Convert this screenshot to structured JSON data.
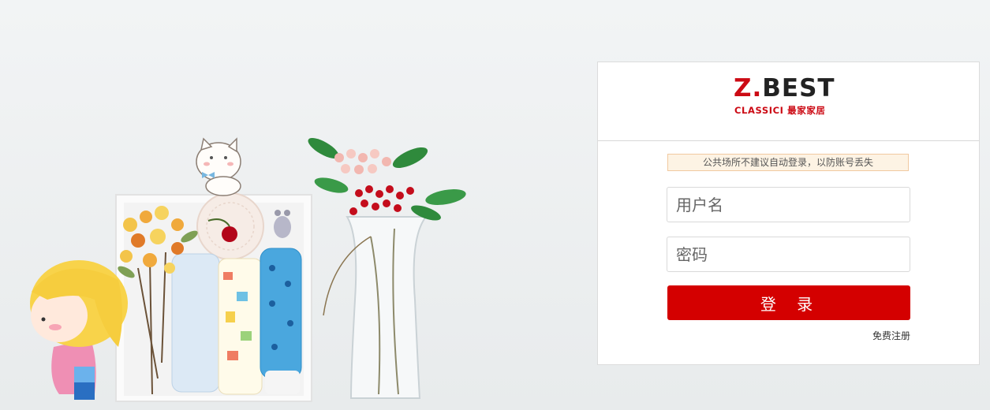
{
  "login": {
    "logo_z": "Z.",
    "logo_best": "BEST",
    "logo_sub": "CLASSICI 最家家居",
    "notice": "公共场所不建议自动登录，以防账号丢失",
    "username_placeholder": "用户名",
    "password_placeholder": "密码",
    "login_button": "登 录",
    "register_link": "免费注册",
    "accent_color": "#d40000"
  }
}
